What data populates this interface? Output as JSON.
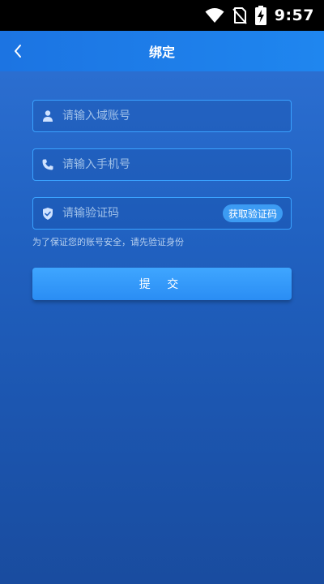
{
  "status_bar": {
    "time": "9:57",
    "icons": [
      "wifi-icon",
      "no-sim-icon",
      "battery-charging-icon"
    ]
  },
  "header": {
    "title": "绑定",
    "back_icon": "chevron-left-icon"
  },
  "form": {
    "account": {
      "placeholder": "请输入域账号",
      "icon": "user-icon"
    },
    "phone": {
      "placeholder": "请输入手机号",
      "icon": "phone-icon"
    },
    "code": {
      "placeholder": "请输验证码",
      "icon": "shield-check-icon",
      "get_code_label": "获取验证码"
    },
    "hint": "为了保证您的账号安全，请先验证身份",
    "submit_label": "提 交"
  },
  "colors": {
    "header": "#1f7fe9",
    "background": "#1c56b0",
    "field_border": "#3aa2ff",
    "button": "#3298f8"
  }
}
